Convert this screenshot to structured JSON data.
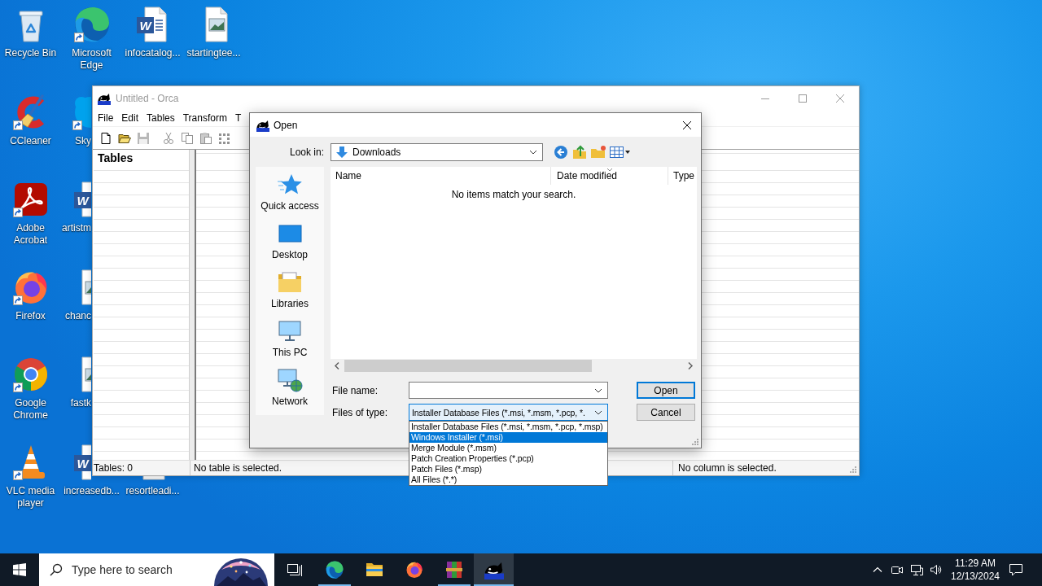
{
  "desktop": {
    "icons": [
      {
        "label": "Recycle Bin",
        "kind": "recycle-bin",
        "shortcut": false
      },
      {
        "label": "Microsoft Edge",
        "kind": "edge",
        "shortcut": true
      },
      {
        "label": "infocatalog...",
        "kind": "word-doc",
        "badge": "W",
        "shortcut": false
      },
      {
        "label": "startingtee...",
        "kind": "image-file",
        "shortcut": false
      },
      {
        "label": "CCleaner",
        "kind": "ccleaner",
        "shortcut": true
      },
      {
        "label": "Sky",
        "kind": "skype",
        "shortcut": true
      },
      {
        "label": "Adobe Acrobat",
        "kind": "acrobat",
        "shortcut": true
      },
      {
        "label": "artistm",
        "kind": "word-doc",
        "badge": "W",
        "shortcut": false
      },
      {
        "label": "Firefox",
        "kind": "firefox",
        "shortcut": true
      },
      {
        "label": "chanc",
        "kind": "image-file",
        "shortcut": false
      },
      {
        "label": "Google Chrome",
        "kind": "chrome",
        "shortcut": true
      },
      {
        "label": "fastk",
        "kind": "image-file",
        "shortcut": false
      },
      {
        "label": "VLC media player",
        "kind": "vlc",
        "shortcut": true
      },
      {
        "label": "increasedb...",
        "kind": "word-doc",
        "badge": "W",
        "shortcut": false
      },
      {
        "label": "resortleadi...",
        "kind": "file",
        "shortcut": false
      }
    ]
  },
  "orca_window": {
    "title": "Untitled - Orca",
    "active": false,
    "menu": [
      "File",
      "Edit",
      "Tables",
      "Transform",
      "T"
    ],
    "toolbar": [
      {
        "kind": "new",
        "disabled": false
      },
      {
        "kind": "open",
        "disabled": false
      },
      {
        "kind": "save",
        "disabled": true
      },
      {
        "kind": "cut",
        "disabled": true
      },
      {
        "kind": "copy",
        "disabled": true
      },
      {
        "kind": "paste",
        "disabled": true
      },
      {
        "kind": "grid",
        "disabled": true
      }
    ],
    "tables_heading": "Tables",
    "status_bar": [
      "Tables: 0",
      "No table is selected.",
      "No column is selected."
    ]
  },
  "open_dialog": {
    "title": "Open",
    "look_in_label": "Look in:",
    "look_in": "Downloads",
    "places": [
      {
        "label": "Quick access",
        "kind": "quick-access"
      },
      {
        "label": "Desktop",
        "kind": "desktop"
      },
      {
        "label": "Libraries",
        "kind": "libraries"
      },
      {
        "label": "This PC",
        "kind": "this-pc"
      },
      {
        "label": "Network",
        "kind": "network"
      }
    ],
    "columns": [
      {
        "label": "Name",
        "sorted": false
      },
      {
        "label": "Date modified",
        "sorted": true
      },
      {
        "label": "Type",
        "sorted": false
      }
    ],
    "empty_message": "No items match your search.",
    "file_name_label": "File name:",
    "file_type_label": "Files of type:",
    "file_type": {
      "value": "Installer Database Files (*.msi, *.msm, *.pcp, *.",
      "focused": true,
      "expanded": true,
      "options": [
        {
          "label": "Installer Database Files (*.msi, *.msm, *.pcp, *.msp)",
          "selected": false
        },
        {
          "label": "Windows Installer (*.msi)",
          "selected": true
        },
        {
          "label": "Merge Module (*.msm)",
          "selected": false
        },
        {
          "label": "Patch Creation Properties (*.pcp)",
          "selected": false
        },
        {
          "label": "Patch Files (*.msp)",
          "selected": false
        },
        {
          "label": "All Files (*.*)",
          "selected": false
        }
      ]
    },
    "buttons": [
      {
        "label": "Open",
        "default": true
      },
      {
        "label": "Cancel",
        "default": false
      }
    ]
  },
  "taskbar": {
    "search": {
      "placeholder": "Type here to search"
    },
    "apps": [
      {
        "kind": "task-view",
        "running": false,
        "active": false
      },
      {
        "kind": "edge",
        "running": true,
        "active": false
      },
      {
        "kind": "file-explorer",
        "running": false,
        "active": false
      },
      {
        "kind": "firefox",
        "running": false,
        "active": false
      },
      {
        "kind": "winrar",
        "running": true,
        "active": false
      },
      {
        "kind": "orca",
        "running": true,
        "active": true
      }
    ],
    "time": "11:29 AM",
    "date": "12/13/2024"
  }
}
